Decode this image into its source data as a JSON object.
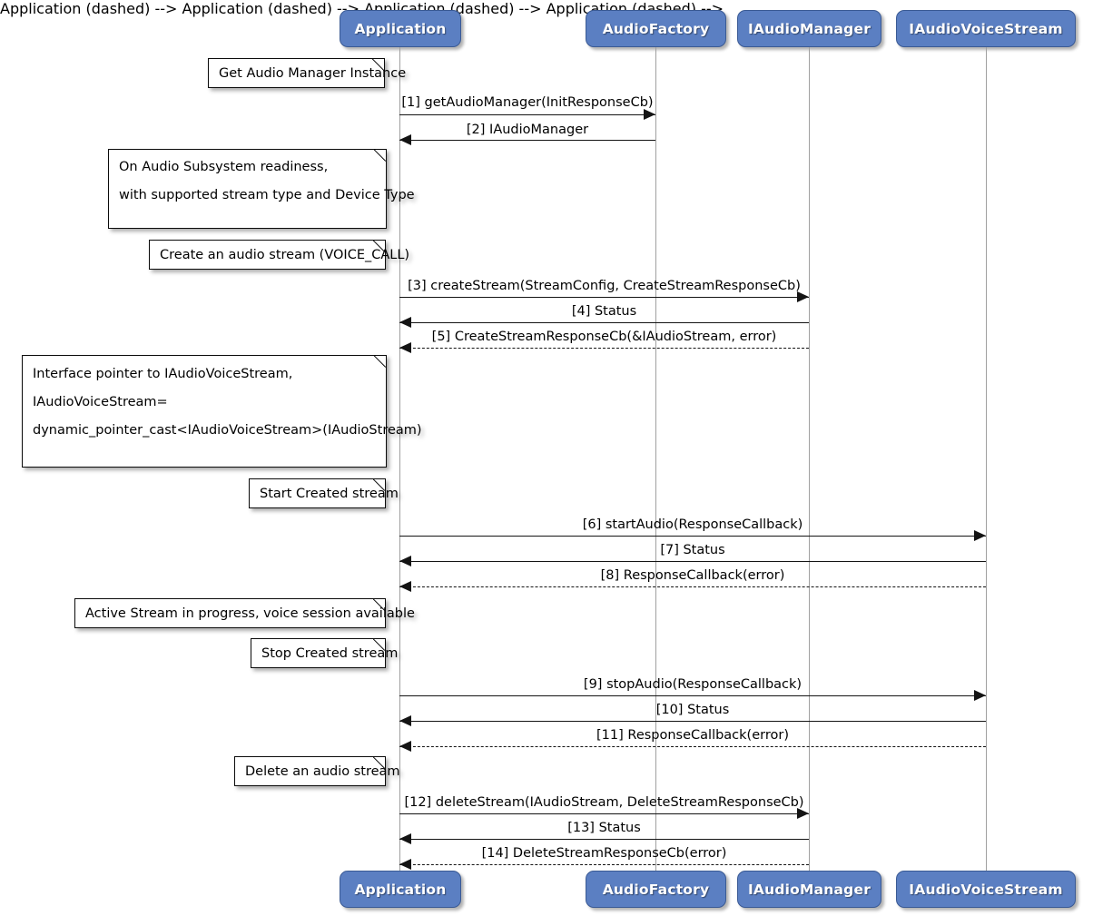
{
  "diagram": {
    "kind": "uml-sequence-diagram",
    "title": "",
    "participant_fill": "#5b7fc2",
    "participant_border": "#3a5a94",
    "participant_text": "#ffffff",
    "line_color": "#141414",
    "lifeline_color": "#a0a0a0",
    "note_fill": "#ffffff",
    "note_border": "#0b0b0b"
  },
  "participants": [
    {
      "id": "application",
      "label": "Application"
    },
    {
      "id": "audiofactory",
      "label": "AudioFactory"
    },
    {
      "id": "iaudiomanager",
      "label": "IAudioManager"
    },
    {
      "id": "iaudiovoicestream",
      "label": "IAudioVoiceStream"
    }
  ],
  "participants_footer": [
    {
      "id": "application",
      "label": "Application"
    },
    {
      "id": "audiofactory",
      "label": "AudioFactory"
    },
    {
      "id": "iaudiomanager",
      "label": "IAudioManager"
    },
    {
      "id": "iaudiovoicestream",
      "label": "IAudioVoiceStream"
    }
  ],
  "notes": [
    {
      "id": "note-get-audio-manager-instance",
      "lines": [
        "Get Audio Manager Instance"
      ]
    },
    {
      "id": "note-audio-subsystem-readiness",
      "lines": [
        "On Audio Subsystem readiness,",
        "with supported stream type and Device Type"
      ]
    },
    {
      "id": "note-create-audio-stream",
      "lines": [
        "Create an audio stream (VOICE_CALL)"
      ]
    },
    {
      "id": "note-interface-pointer",
      "lines": [
        "Interface pointer to IAudioVoiceStream,",
        "IAudioVoiceStream=",
        "dynamic_pointer_cast<IAudioVoiceStream>(IAudioStream)"
      ]
    },
    {
      "id": "note-start-created-stream",
      "lines": [
        "Start Created stream"
      ]
    },
    {
      "id": "note-active-stream",
      "lines": [
        "Active Stream in progress, voice session available"
      ]
    },
    {
      "id": "note-stop-created-stream",
      "lines": [
        "Stop Created stream"
      ]
    },
    {
      "id": "note-delete-audio-stream",
      "lines": [
        "Delete an audio stream"
      ]
    }
  ],
  "messages": [
    {
      "seq": "1",
      "label": "[1] getAudioManager(InitResponseCb)"
    },
    {
      "seq": "2",
      "label": "[2] IAudioManager"
    },
    {
      "seq": "3",
      "label": "[3] createStream(StreamConfig, CreateStreamResponseCb)"
    },
    {
      "seq": "4",
      "label": "[4] Status"
    },
    {
      "seq": "5",
      "label": "[5] CreateStreamResponseCb(&IAudioStream, error)"
    },
    {
      "seq": "6",
      "label": "[6] startAudio(ResponseCallback)"
    },
    {
      "seq": "7",
      "label": "[7] Status"
    },
    {
      "seq": "8",
      "label": "[8] ResponseCallback(error)"
    },
    {
      "seq": "9",
      "label": "[9] stopAudio(ResponseCallback)"
    },
    {
      "seq": "10",
      "label": "[10] Status"
    },
    {
      "seq": "11",
      "label": "[11] ResponseCallback(error)"
    },
    {
      "seq": "12",
      "label": "[12] deleteStream(IAudioStream, DeleteStreamResponseCb)"
    },
    {
      "seq": "13",
      "label": "[13] Status"
    },
    {
      "seq": "14",
      "label": "[14] DeleteStreamResponseCb(error)"
    }
  ]
}
